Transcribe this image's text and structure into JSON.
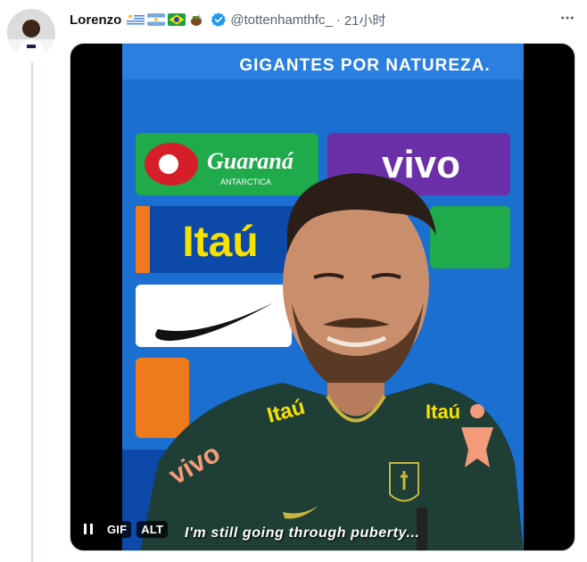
{
  "author": {
    "name": "Lorenzo",
    "flags": [
      "uruguay-flag",
      "argentina-flag",
      "brazil-flag",
      "mate-emoji"
    ],
    "handle": "@tottenhamthfc_",
    "separator": "·",
    "timestamp": "21小时"
  },
  "media": {
    "sign_top": "GIGANTES POR NATUREZA.",
    "sponsor_1": "Guaraná",
    "sponsor_1b": "ANTARCTICA",
    "sponsor_2": "Itaú",
    "sponsor_3": "vivo",
    "shirt_brand_1": "Itaú",
    "shirt_brand_2": "vivo",
    "badge_label_gif": "GIF",
    "badge_label_alt": "ALT",
    "subtitle": "I'm still going through puberty..."
  },
  "colors": {
    "blue_wall": "#1a6fd1",
    "shirt": "#1f3f36",
    "verified": "#1d9bf0"
  }
}
